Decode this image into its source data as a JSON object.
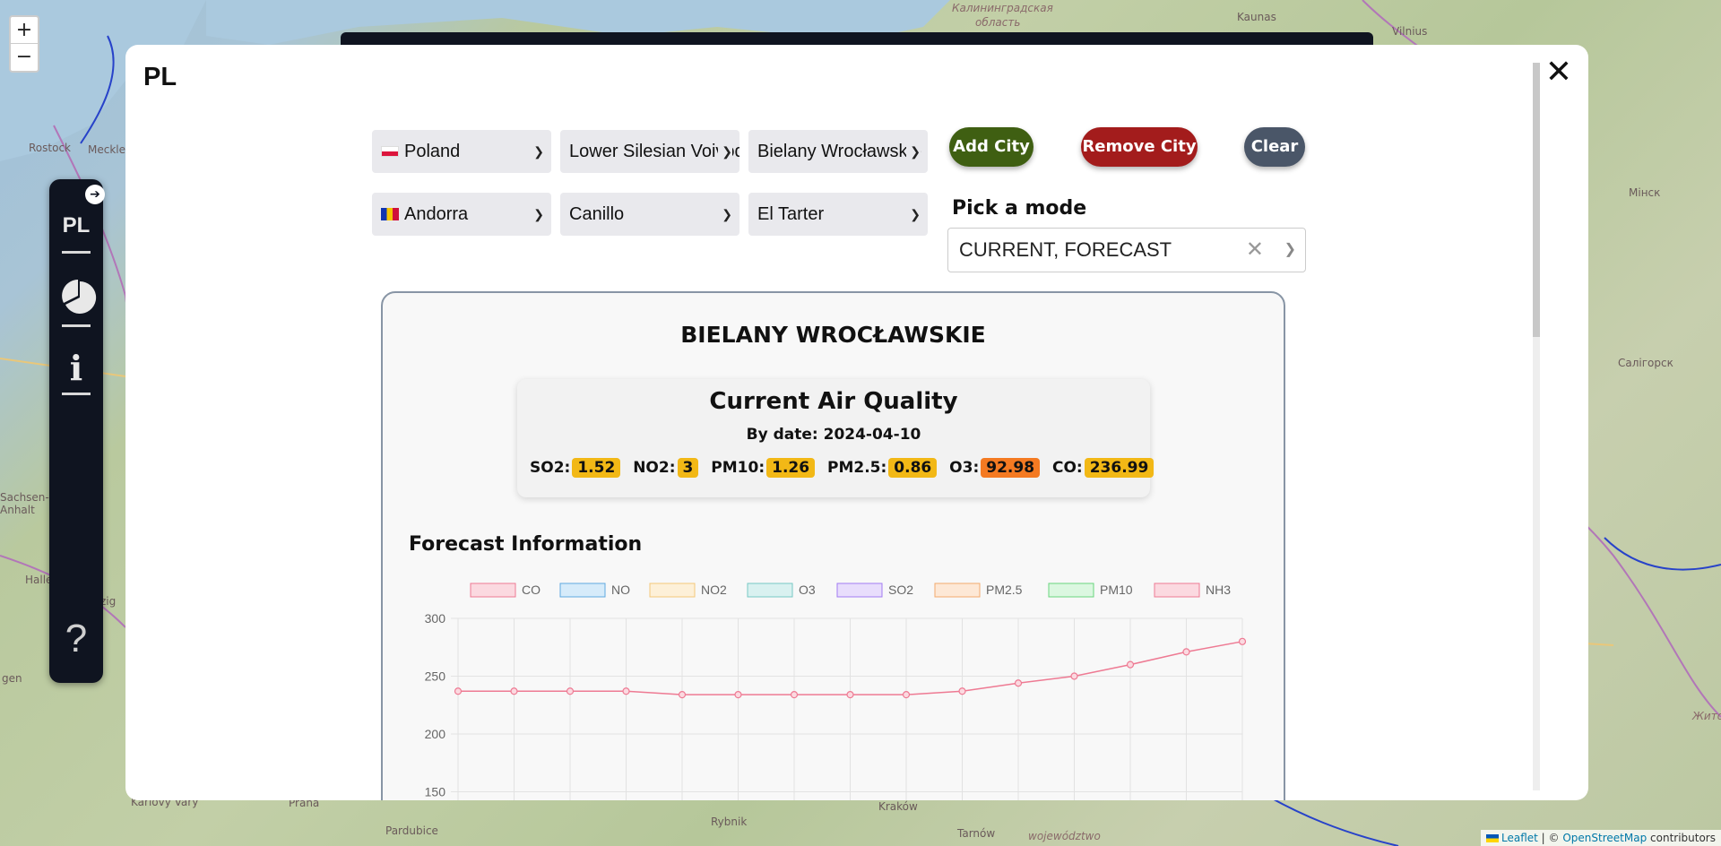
{
  "map": {
    "labels": [
      {
        "text": "Калининградская",
        "italic": true
      },
      {
        "text": "область",
        "italic": true
      },
      {
        "text": "Kaunas"
      },
      {
        "text": "Vilnius"
      },
      {
        "text": "Rostock"
      },
      {
        "text": "Meckle"
      },
      {
        "text": "Мінск"
      },
      {
        "text": "Салігорск"
      },
      {
        "text": "Halle"
      },
      {
        "text": "Kraków"
      },
      {
        "text": "Rybnik"
      },
      {
        "text": "Tarnów"
      },
      {
        "text": "Praha"
      },
      {
        "text": "Pardubice"
      },
      {
        "text": "Karlovy Vary"
      },
      {
        "text": "województwo",
        "italic": true
      },
      {
        "text": "Жито"
      },
      {
        "text": "Sachsen-Anhalt"
      },
      {
        "text": "zig"
      },
      {
        "text": "gen"
      }
    ],
    "zoom_in": "+",
    "zoom_out": "−",
    "attribution": {
      "leaflet": "Leaflet",
      "sep": " | © ",
      "osm": "OpenStreetMap",
      "suffix": " contributors"
    }
  },
  "sidebar": {
    "toggle": "➔",
    "code": "PL",
    "pie_icon": "pie-chart-icon",
    "info": "i",
    "help": "?"
  },
  "modal": {
    "title": "PL",
    "close": "✕",
    "row1": {
      "country": "Poland",
      "region": "Lower Silesian Voivodeship",
      "city": "Bielany Wrocławskie"
    },
    "row2": {
      "country": "Andorra",
      "region": "Canillo",
      "city": "El Tarter"
    },
    "buttons": {
      "add": "Add City",
      "remove": "Remove City",
      "clear": "Clear"
    },
    "colors": {
      "add": "#3f5f12",
      "remove": "#a31c1c",
      "clear": "#4a5668"
    },
    "mode": {
      "label": "Pick a mode",
      "value": "CURRENT, FORECAST"
    }
  },
  "card": {
    "city": "BIELANY WROCŁAWSKIE",
    "current": {
      "title": "Current Air Quality",
      "date": "By date: 2024-04-10",
      "pollutants": [
        {
          "label": "SO2:",
          "value": "1.52",
          "color": "#f2b816"
        },
        {
          "label": "NO2:",
          "value": "3",
          "color": "#f2b816"
        },
        {
          "label": "PM10:",
          "value": "1.26",
          "color": "#f2b816"
        },
        {
          "label": "PM2.5:",
          "value": "0.86",
          "color": "#f2b816"
        },
        {
          "label": "O3:",
          "value": "92.98",
          "color": "#f47a22"
        },
        {
          "label": "CO:",
          "value": "236.99",
          "color": "#f2b816"
        }
      ]
    },
    "forecast_title": "Forecast Information"
  },
  "chart_data": {
    "type": "line",
    "legend": [
      {
        "name": "CO",
        "fill": "#fbd9e0",
        "stroke": "#ee7a93"
      },
      {
        "name": "NO",
        "fill": "#d6ebfa",
        "stroke": "#5fa8e0"
      },
      {
        "name": "NO2",
        "fill": "#fdf0d8",
        "stroke": "#f3c77a"
      },
      {
        "name": "O3",
        "fill": "#d9f1f0",
        "stroke": "#77c9c4"
      },
      {
        "name": "SO2",
        "fill": "#e8ddfc",
        "stroke": "#a27cf2"
      },
      {
        "name": "PM2.5",
        "fill": "#fde8d6",
        "stroke": "#f2aa6e"
      },
      {
        "name": "PM10",
        "fill": "#dbf7e0",
        "stroke": "#6ad47e"
      },
      {
        "name": "NH3",
        "fill": "#fbd9e0",
        "stroke": "#ee7a93"
      }
    ],
    "yticks": [
      "300",
      "250",
      "200",
      "150"
    ],
    "ylim": [
      150,
      300
    ],
    "series": [
      {
        "name": "CO",
        "color": "#ee7a93",
        "values": [
          237,
          237,
          237,
          237,
          234,
          234,
          234,
          234,
          234,
          237,
          244,
          250,
          260,
          271,
          280
        ]
      }
    ]
  }
}
